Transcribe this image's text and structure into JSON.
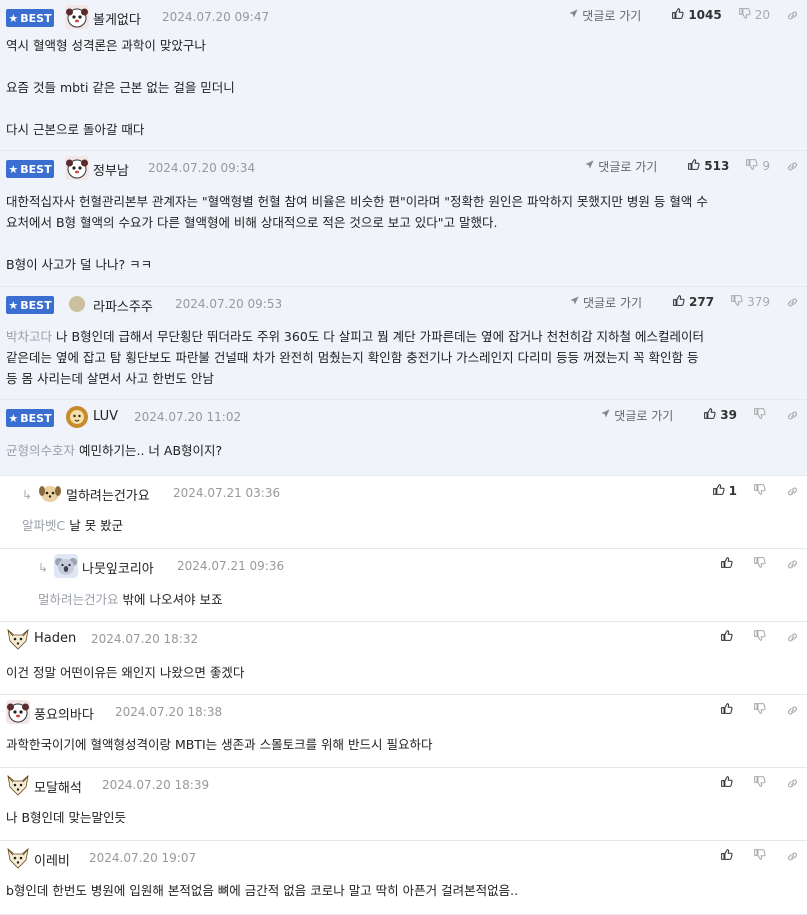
{
  "goto_label": "댓글로 가기",
  "best_label": "BEST",
  "colors": {
    "best_bg": "#f0f3fa",
    "badge": "#3a6fd1",
    "date": "#999999",
    "mention": "#9aa0aa"
  },
  "comments": [
    {
      "best": true,
      "nick": "볼게없다",
      "date": "2024.07.20 09:47",
      "up": "1045",
      "down": "20",
      "avatar": "dog",
      "lines": [
        "역시 혈액형 성격론은 과학이 맞았구나",
        "",
        "요즘 것들 mbti 같은 근본 없는 걸을 믿더니",
        "",
        "다시 근본으로 돌아갈 때다"
      ]
    },
    {
      "best": true,
      "nick": "정부남",
      "date": "2024.07.20 09:34",
      "up": "513",
      "down": "9",
      "avatar": "dog",
      "lines": [
        "대한적십자사 헌혈관리본부 관계자는 \"혈액형별 헌혈 참여 비율은 비슷한 편\"이라며 \"정확한 원인은 파악하지 못했지만 병원 등 혈액 수",
        "요처에서 B형 혈액의 수요가 다른 혈액형에 비해 상대적으로 적은 것으로 보고 있다\"고 말했다.",
        "",
        "B형이 사고가 덜 나나? ㅋㅋ"
      ]
    },
    {
      "best": true,
      "nick": "라파스주주",
      "date": "2024.07.20 09:53",
      "up": "277",
      "down": "379",
      "avatar": "dot",
      "mention": "박차고다",
      "lines": [
        "나 B형인데 급해서 무단횡단 뛰더라도 주위 360도 다 살피고 뭠 계단 가파른데는 옆에 잡거나 천천히감 지하철 에스컬레이터",
        "같은데는 옆에 잡고 탐 횡단보도 파란불 건널때 차가 완전히 멈췄는지 확인함 충전기나 가스레인지 다리미 등등 꺼졌는지 꼭 확인함 등",
        "등 몸 사리는데 살면서 사고 한번도 안남"
      ]
    },
    {
      "best": true,
      "nick": "LUV",
      "date": "2024.07.20 11:02",
      "up": "39",
      "down": "",
      "avatar": "lion",
      "mention": "균형의수호자",
      "lines": [
        "예민하기는.. 너 AB형이지?"
      ]
    },
    {
      "best": false,
      "reply": 1,
      "nick": "멀하려는건가요",
      "date": "2024.07.21 03:36",
      "up": "1",
      "down": "",
      "avatar": "pup",
      "mention": "알파벳C",
      "lines": [
        "날 못 봤군"
      ]
    },
    {
      "best": false,
      "reply": 2,
      "nick": "나뭇잎코리아",
      "date": "2024.07.21 09:36",
      "up": "",
      "down": "",
      "avatar": "koala",
      "mention": "멀하려는건가요",
      "lines": [
        "밖에 나오셔야 보죠"
      ]
    },
    {
      "best": false,
      "nick": "Haden",
      "date": "2024.07.20 18:32",
      "up": "",
      "down": "",
      "avatar": "fox",
      "lines": [
        "이건 정말 어떤이유든 왜인지 나왔으면 좋겠다"
      ]
    },
    {
      "best": false,
      "nick": "풍요의바다",
      "date": "2024.07.20 18:38",
      "up": "",
      "down": "",
      "avatar": "dog",
      "lines": [
        "과학한국이기에 혈액형성격이랑 MBTI는 생존과 스몰토크를 위해 반드시 필요하다"
      ]
    },
    {
      "best": false,
      "nick": "모달해석",
      "date": "2024.07.20 18:39",
      "up": "",
      "down": "",
      "avatar": "fox",
      "lines": [
        "나 B형인데 맞는말인듯"
      ]
    },
    {
      "best": false,
      "nick": "이레비",
      "date": "2024.07.20 19:07",
      "up": "",
      "down": "",
      "avatar": "fox",
      "lines": [
        "b형인데 한번도 병원에 입원해 본적없음 뼈에 금간적 없음 코로나 말고 딱히 아픈거 걸려본적없음.."
      ]
    }
  ]
}
